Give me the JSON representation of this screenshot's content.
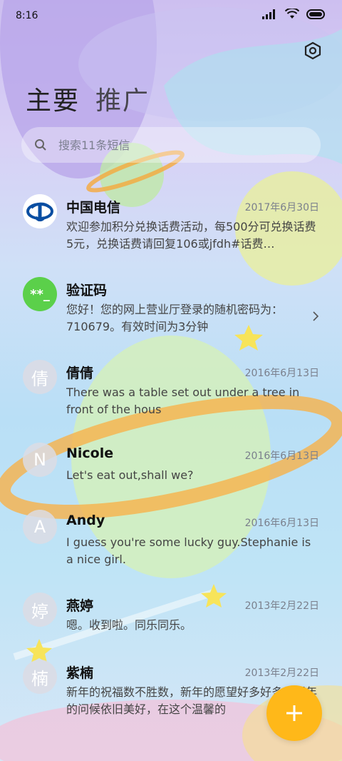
{
  "status": {
    "time": "8:16"
  },
  "tabs": [
    {
      "label": "主要"
    },
    {
      "label": "推广"
    }
  ],
  "search": {
    "placeholder": "搜索11条短信"
  },
  "conversations": [
    {
      "name": "中国电信",
      "date": "2017年6月30日",
      "preview": "欢迎参加积分兑换话费活动，每500分可兑换话费5元，兑换话费请回复106或jfdh#话费…",
      "avatar_type": "logo"
    },
    {
      "name": "验证码",
      "date": "",
      "preview": "您好！您的网上营业厅登录的随机密码为：710679。有效时间为3分钟",
      "avatar_type": "code",
      "avatar_text": "**_"
    },
    {
      "name": "倩倩",
      "date": "2016年6月13日",
      "preview": "There was a table set out under a tree in front of the hous",
      "avatar_text": "倩"
    },
    {
      "name": "Nicole",
      "date": "2016年6月13日",
      "preview": "Let's eat out,shall we?",
      "avatar_text": "N"
    },
    {
      "name": "Andy",
      "date": "2016年6月13日",
      "preview": "I guess you're some lucky guy.Stephanie is a nice girl.",
      "avatar_text": "A"
    },
    {
      "name": "燕婷",
      "date": "2013年2月22日",
      "preview": "嗯。收到啦。同乐同乐。",
      "avatar_text": "婷"
    },
    {
      "name": "紫楠",
      "date": "2013年2月22日",
      "preview": "新年的祝福数不胜数，新年的愿望好多好多，新年的问候依旧美好，在这个温馨的",
      "avatar_text": "楠"
    }
  ],
  "colors": {
    "fab": "#ffb819",
    "verify_avatar": "#5bd04a",
    "telecom_blue": "#0a4ea2"
  },
  "icons": {
    "settings": "settings-icon",
    "search": "search-icon",
    "compose": "plus-icon",
    "chevron": "chevron-right-icon"
  }
}
